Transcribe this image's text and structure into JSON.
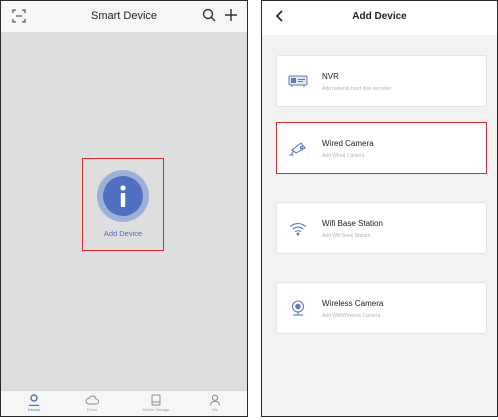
{
  "colors": {
    "accent": "#4f6fc2",
    "highlight_box": "#e0282e"
  },
  "left_screen": {
    "header": {
      "title": "Smart Device",
      "icons": [
        "scan-icon",
        "search-icon",
        "plus-icon"
      ]
    },
    "add_device": {
      "label": "Add Device",
      "icon": "info-icon"
    },
    "tabbar": [
      {
        "label": "Device",
        "icon": "person-icon",
        "active": true
      },
      {
        "label": "Event",
        "icon": "cloud-icon",
        "active": false
      },
      {
        "label": "Mobile Storage",
        "icon": "storage-icon",
        "active": false
      },
      {
        "label": "Me",
        "icon": "user-icon",
        "active": false
      }
    ]
  },
  "right_screen": {
    "header": {
      "title": "Add Device",
      "back_icon": "chevron-left-icon"
    },
    "options": [
      {
        "title": "NVR",
        "subtitle": "Add network hard disk recorder",
        "icon": "nvr-icon",
        "selected": false
      },
      {
        "title": "Wired Camera",
        "subtitle": "Add Wired Camera",
        "icon": "camera-icon",
        "selected": true
      },
      {
        "title": "Wifi Base Station",
        "subtitle": "Add Wifi Base Station",
        "icon": "wifi-icon",
        "selected": false
      },
      {
        "title": "Wireless Camera",
        "subtitle": "Add Wifi/Wireless Camera",
        "icon": "wireless-camera-icon",
        "selected": false
      }
    ]
  }
}
